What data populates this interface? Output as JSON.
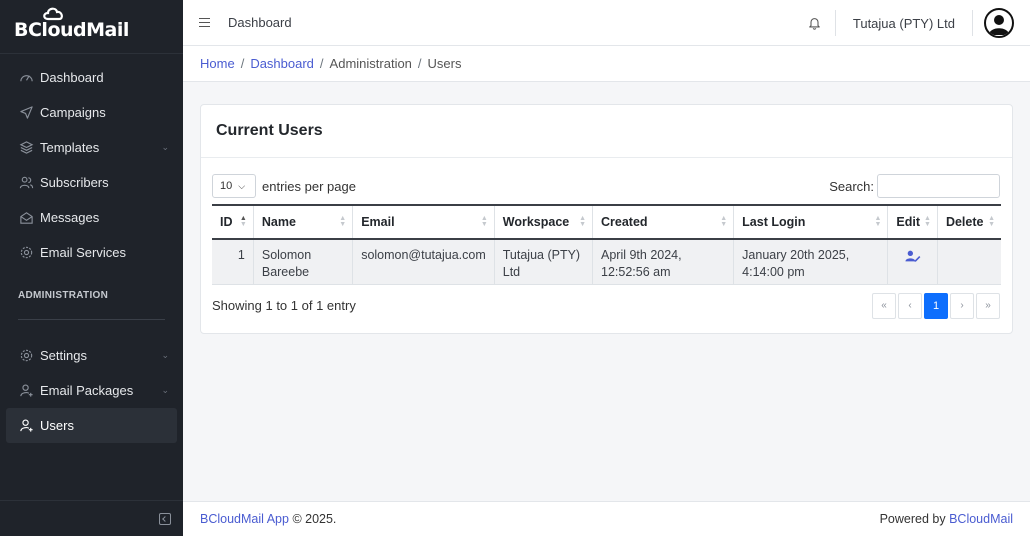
{
  "brand": {
    "name": "BCloudMail"
  },
  "sidebar": {
    "items": [
      {
        "label": "Dashboard",
        "icon": "speedometer-icon"
      },
      {
        "label": "Campaigns",
        "icon": "send-icon"
      },
      {
        "label": "Templates",
        "icon": "layers-icon"
      },
      {
        "label": "Subscribers",
        "icon": "users-icon"
      },
      {
        "label": "Messages",
        "icon": "envelope-open-icon"
      },
      {
        "label": "Email Services",
        "icon": "gear-icon"
      }
    ],
    "section_label": "ADMINISTRATION",
    "admin_items": [
      {
        "label": "Settings",
        "icon": "gear-icon"
      },
      {
        "label": "Email Packages",
        "icon": "user-plus-icon"
      },
      {
        "label": "Users",
        "icon": "user-plus-icon",
        "active": true
      }
    ]
  },
  "header": {
    "title": "Dashboard",
    "org_name": "Tutajua (PTY) Ltd"
  },
  "breadcrumb": {
    "home": "Home",
    "dashboard": "Dashboard",
    "admin": "Administration",
    "current": "Users",
    "separator": "/"
  },
  "card": {
    "title": "Current Users",
    "length_value": "10",
    "length_text": "entries per page",
    "search_label": "Search:",
    "search_value": "",
    "columns": [
      "ID",
      "Name",
      "Email",
      "Workspace",
      "Created",
      "Last Login",
      "Edit",
      "Delete"
    ],
    "rows": [
      {
        "id": "1",
        "name": "Solomon Bareebe",
        "email": "solomon@tutajua.com",
        "workspace": "Tutajua (PTY) Ltd",
        "created": "April 9th 2024, 12:52:56 am",
        "last_login": "January 20th 2025, 4:14:00 pm"
      }
    ],
    "info": "Showing 1 to 1 of 1 entry",
    "pager": {
      "first": "«",
      "prev": "‹",
      "page": "1",
      "next": "›",
      "last": "»"
    }
  },
  "footer": {
    "app_link": "BCloudMail App",
    "copyright": "© 2025.",
    "powered_by": "Powered by",
    "powered_link": "BCloudMail"
  },
  "colors": {
    "accent": "#4a5cd1",
    "sidebar_bg": "#1f232a",
    "page_active": "#0d6efd"
  }
}
